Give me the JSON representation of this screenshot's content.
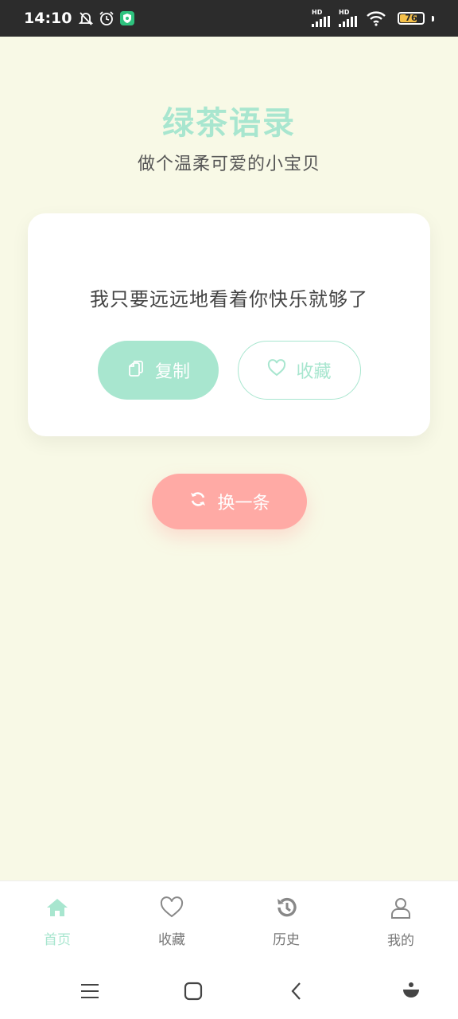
{
  "status_bar": {
    "time": "14:10",
    "battery": "76",
    "signal_label_1": "HD",
    "signal_label_2": "HD",
    "colors": {
      "background": "#2c2c2c",
      "battery_fill": "#f5c04a"
    }
  },
  "header": {
    "title": "绿茶语录",
    "subtitle": "做个温柔可爱的小宝贝"
  },
  "quote": {
    "text": "我只要远远地看着你快乐就够了"
  },
  "actions": {
    "copy_label": "复制",
    "favorite_label": "收藏",
    "refresh_label": "换一条"
  },
  "tabs": [
    {
      "label": "首页",
      "icon": "home-icon",
      "active": true
    },
    {
      "label": "收藏",
      "icon": "heart-icon",
      "active": false
    },
    {
      "label": "历史",
      "icon": "history-icon",
      "active": false
    },
    {
      "label": "我的",
      "icon": "user-icon",
      "active": false
    }
  ],
  "system_nav": {
    "icons": [
      "menu-icon",
      "home-square-icon",
      "back-icon",
      "assistant-icon"
    ]
  },
  "colors": {
    "background": "#f8f9e6",
    "accent_green": "#a8e6cf",
    "accent_pink": "#ffaaa5",
    "text_gray": "#555555"
  }
}
